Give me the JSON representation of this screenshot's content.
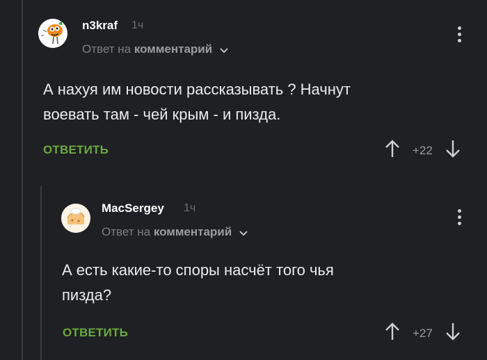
{
  "comments": [
    {
      "author": "n3kraf",
      "time": "1ч",
      "reply_prefix": "Ответ на",
      "reply_target": "комментарий",
      "text_line1": "А нахуя им новости рассказывать ? Начнут",
      "text_line2": "воевать там - чей крым - и пизда.",
      "reply_label": "ОТВЕТИТЬ",
      "score": "+22"
    },
    {
      "author": "MacSergey",
      "time": "1ч",
      "reply_prefix": "Ответ на",
      "reply_target": "комментарий",
      "text_line1": "А есть какие-то споры насчёт того чья",
      "text_line2": "пизда?",
      "reply_label": "ОТВЕТИТЬ",
      "score": "+27"
    }
  ],
  "colors": {
    "background": "#1f2023",
    "accent": "#6aa843",
    "muted": "#7c7e82"
  },
  "icons": [
    "upvote-arrow-icon",
    "downvote-arrow-icon",
    "more-vertical-icon",
    "chevron-down-icon"
  ]
}
